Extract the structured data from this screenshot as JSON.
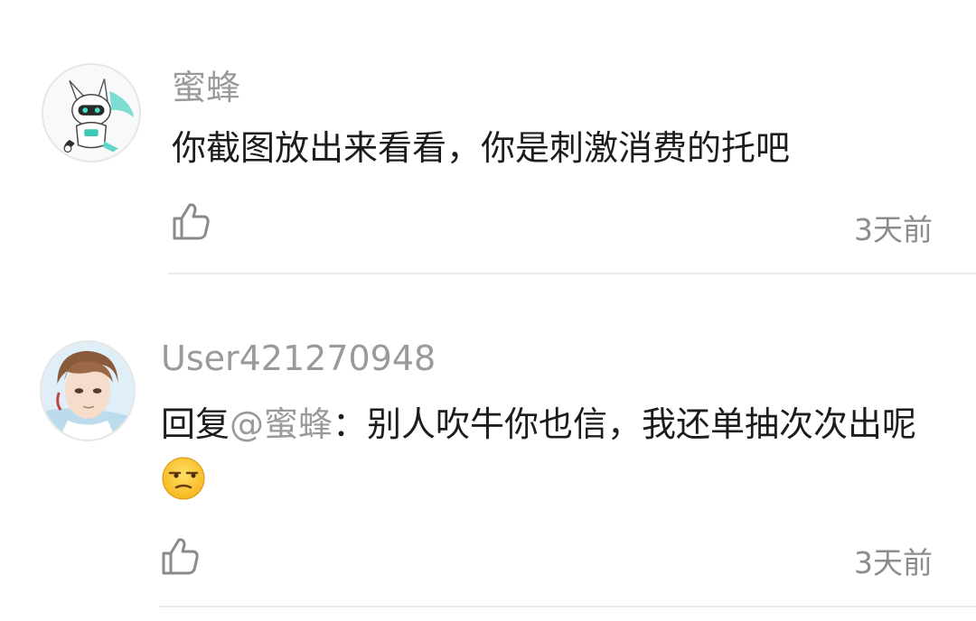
{
  "comments": [
    {
      "username": "蜜蜂",
      "text": "你截图放出来看看，你是刺激消费的托吧",
      "time": "3天前",
      "avatar_icon": "robot-character-icon",
      "like_icon": "thumbs-up-icon"
    },
    {
      "username": "User421270948",
      "reply_prefix": "回复",
      "mention": "@蜜蜂",
      "text": "：别人吹牛你也信，我还单抽次次出呢",
      "emoji_icon": "unamused-face-icon",
      "time": "3天前",
      "avatar_icon": "anime-boy-icon",
      "like_icon": "thumbs-up-icon"
    }
  ],
  "colors": {
    "username": "#9a9a9a",
    "text": "#1c1c1c",
    "time": "#8c8c8c",
    "divider": "#ececec"
  }
}
